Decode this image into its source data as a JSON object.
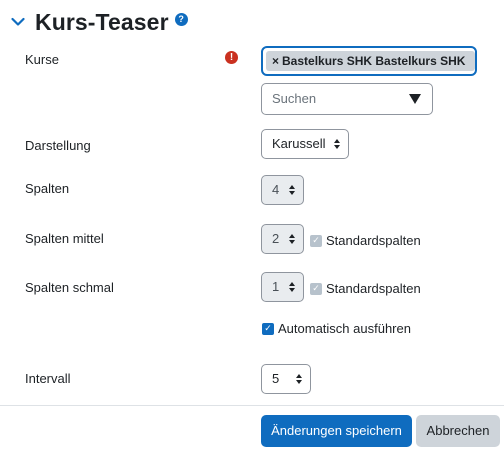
{
  "section": {
    "title": "Kurs-Teaser"
  },
  "fields": {
    "kurse": {
      "label": "Kurse",
      "chip": "Bastelkurs SHK Bastelkurs SHK",
      "chip_remove": "×",
      "search_placeholder": "Suchen"
    },
    "darstellung": {
      "label": "Darstellung",
      "value": "Karussell"
    },
    "spalten": {
      "label": "Spalten",
      "value": "4"
    },
    "spalten_mittel": {
      "label": "Spalten mittel",
      "value": "2",
      "checkbox_label": "Standardspalten"
    },
    "spalten_schmal": {
      "label": "Spalten schmal",
      "value": "1",
      "checkbox_label": "Standardspalten"
    },
    "autoplay": {
      "label": "Automatisch ausführen"
    },
    "intervall": {
      "label": "Intervall",
      "value": "5"
    }
  },
  "buttons": {
    "save": "Änderungen speichern",
    "cancel": "Abbrechen"
  },
  "colors": {
    "primary": "#0f6cbf",
    "required": "#ca3120",
    "secondary": "#ced4da"
  },
  "icons": {
    "collapse": "chevron-down-icon",
    "help": "help-icon",
    "required": "required-icon",
    "dropdown": "caret-down-icon",
    "check": "check-icon"
  }
}
